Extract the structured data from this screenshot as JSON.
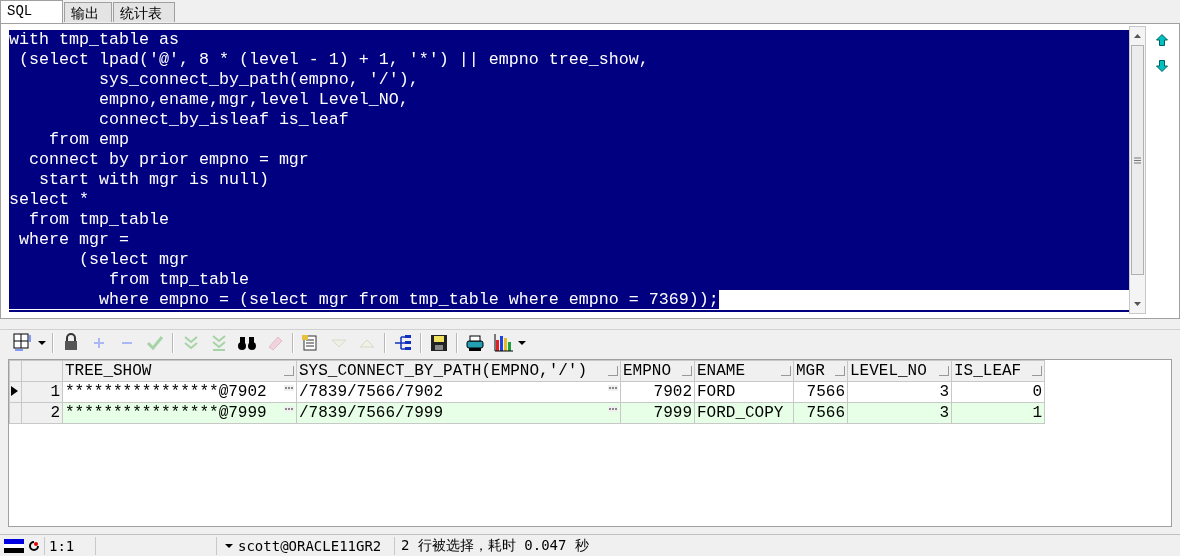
{
  "tabs": [
    {
      "label": "SQL",
      "selected": true
    },
    {
      "label": "输出",
      "selected": false
    },
    {
      "label": "统计表",
      "selected": false
    }
  ],
  "editor": {
    "selected": true,
    "lines": [
      "with tmp_table as",
      " (select lpad('@', 8 * (level - 1) + 1, '*') || empno tree_show,",
      "         sys_connect_by_path(empno, '/'),",
      "         empno,ename,mgr,level Level_NO,",
      "         connect_by_isleaf is_leaf",
      "    from emp",
      "  connect by prior empno = mgr",
      "   start with mgr is null)",
      "select *",
      "  from tmp_table",
      " where mgr =",
      "       (select mgr",
      "          from tmp_table",
      "         where empno = (select mgr from tmp_table where empno = 7369));"
    ]
  },
  "toolbar": [
    {
      "kind": "grid",
      "disabled": false
    },
    {
      "kind": "sep"
    },
    {
      "kind": "lock",
      "disabled": false
    },
    {
      "kind": "plus",
      "disabled": true
    },
    {
      "kind": "minus",
      "disabled": true
    },
    {
      "kind": "check",
      "disabled": true
    },
    {
      "kind": "sep"
    },
    {
      "kind": "down",
      "disabled": true
    },
    {
      "kind": "last",
      "disabled": true
    },
    {
      "kind": "find",
      "disabled": false
    },
    {
      "kind": "eraser",
      "disabled": true
    },
    {
      "kind": "sep"
    },
    {
      "kind": "query",
      "disabled": false
    },
    {
      "kind": "tri-down",
      "disabled": true
    },
    {
      "kind": "tri-up",
      "disabled": true
    },
    {
      "kind": "sep"
    },
    {
      "kind": "tree",
      "disabled": false
    },
    {
      "kind": "sep"
    },
    {
      "kind": "save",
      "disabled": false
    },
    {
      "kind": "sep"
    },
    {
      "kind": "print",
      "disabled": false
    },
    {
      "kind": "chart",
      "disabled": false
    }
  ],
  "grid": {
    "columns": [
      {
        "label": "TREE_SHOW"
      },
      {
        "label": "SYS_CONNECT_BY_PATH(EMPNO,'/')"
      },
      {
        "label": "EMPNO"
      },
      {
        "label": "ENAME"
      },
      {
        "label": "MGR"
      },
      {
        "label": "LEVEL_NO"
      },
      {
        "label": "IS_LEAF"
      }
    ],
    "rows": [
      {
        "number": "1",
        "selected": true,
        "cells": [
          "****************@7902",
          "/7839/7566/7902",
          "7902",
          "FORD",
          "7566",
          "3",
          "0"
        ]
      },
      {
        "number": "2",
        "selected": false,
        "cells": [
          "****************@7999",
          "/7839/7566/7999",
          "7999",
          "FORD_COPY",
          "7566",
          "3",
          "1"
        ]
      }
    ]
  },
  "status_bar": {
    "position": "1:1",
    "connection": "scott@ORACLE11GR2",
    "message": "2 行被选择，耗时 0.047 秒"
  }
}
